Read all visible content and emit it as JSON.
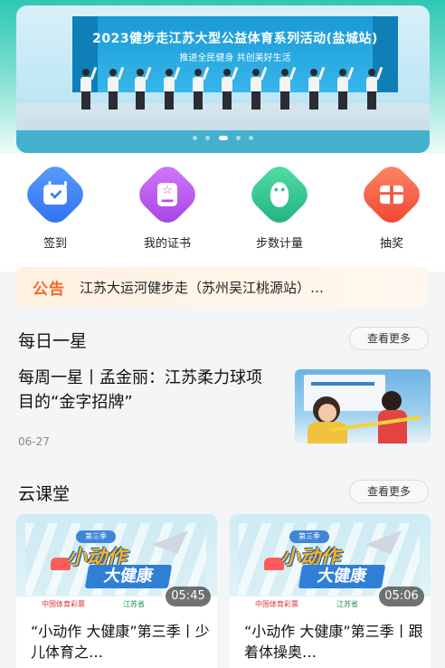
{
  "colors": {
    "accent_teal": "#2fc7b4",
    "notice_orange": "#f2692b",
    "icon_checkin": "#3b7cf0",
    "icon_cert": "#b54fe0",
    "icon_steps": "#33c08f",
    "icon_lottery": "#f2553d"
  },
  "banner": {
    "title": "2023健步走江苏大型公益体育系列活动(盐城站)",
    "subtitle": "推进全民健身 共创美好生活"
  },
  "quick_actions": [
    {
      "label": "签到",
      "icon": "calendar-check-icon"
    },
    {
      "label": "我的证书",
      "icon": "certificate-icon"
    },
    {
      "label": "步数计量",
      "icon": "footprint-icon"
    },
    {
      "label": "抽奖",
      "icon": "gift-icon"
    }
  ],
  "notice": {
    "tag": "公告",
    "text": "江苏大运河健步走（苏州吴江桃源站）…"
  },
  "daily_star": {
    "section_title": "每日一星",
    "more_label": "查看更多",
    "article_title": "每周一星丨孟金丽：江苏柔力球项目的“金字招牌”",
    "date": "06-27"
  },
  "cloud_class": {
    "section_title": "云课堂",
    "more_label": "查看更多",
    "thumb_text": {
      "season": "第三季",
      "line1": "小动作",
      "line2": "大健康",
      "logo1": "中国体育彩票",
      "logo2": "江苏省"
    },
    "videos": [
      {
        "duration": "05:45",
        "title": "“小动作 大健康”第三季丨少儿体育之…"
      },
      {
        "duration": "05:06",
        "title": "“小动作 大健康”第三季丨跟着体操奥…"
      }
    ]
  }
}
